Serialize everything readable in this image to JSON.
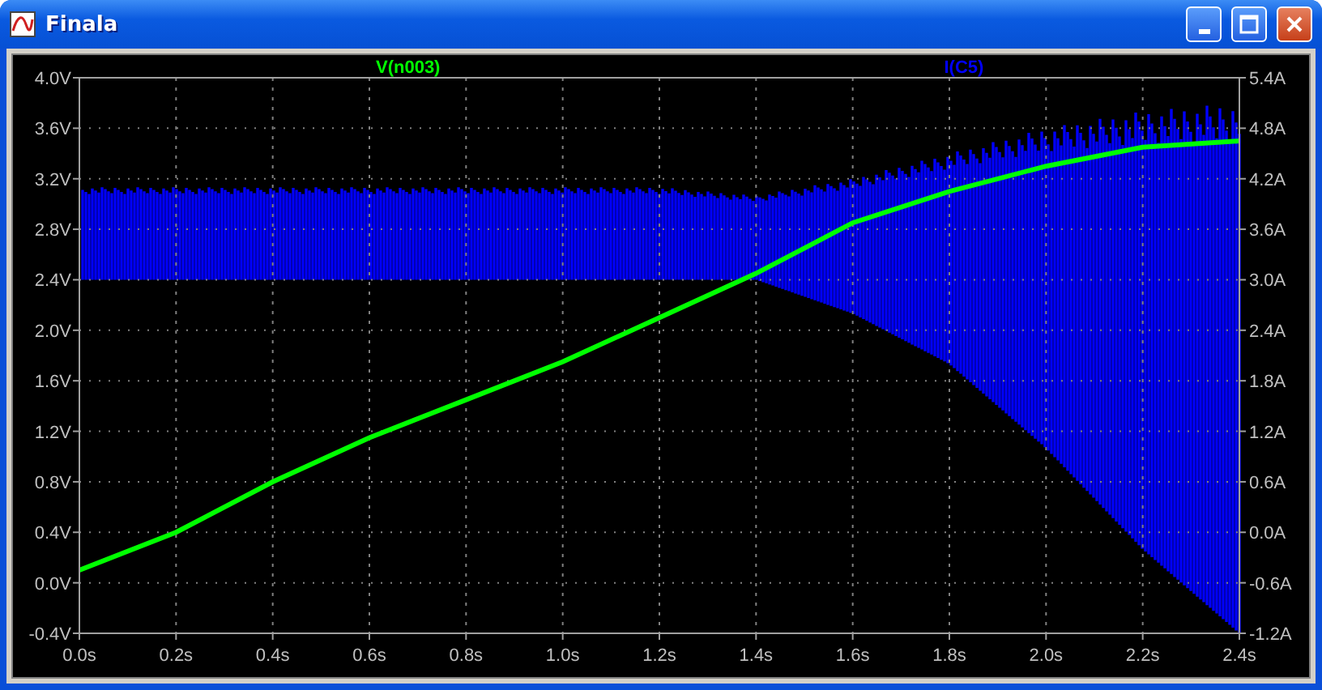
{
  "window": {
    "title": "Finala"
  },
  "plot": {
    "chart_data": {
      "type": "line",
      "x": [
        0,
        0.2,
        0.4,
        0.6,
        0.8,
        1.0,
        1.2,
        1.4,
        1.6,
        1.8,
        2.0,
        2.2,
        2.4
      ],
      "xlim": [
        0,
        2.4
      ],
      "ylim": [
        -0.4,
        4.0
      ],
      "xticks": [
        {
          "value": 0,
          "label": "0.0s"
        },
        {
          "value": 0.2,
          "label": "0.2s"
        },
        {
          "value": 0.4,
          "label": "0.4s"
        },
        {
          "value": 0.6,
          "label": "0.6s"
        },
        {
          "value": 0.8,
          "label": "0.8s"
        },
        {
          "value": 1.0,
          "label": "1.0s"
        },
        {
          "value": 1.2,
          "label": "1.2s"
        },
        {
          "value": 1.4,
          "label": "1.4s"
        },
        {
          "value": 1.6,
          "label": "1.6s"
        },
        {
          "value": 1.8,
          "label": "1.8s"
        },
        {
          "value": 2.0,
          "label": "2.0s"
        },
        {
          "value": 2.2,
          "label": "2.2s"
        },
        {
          "value": 2.4,
          "label": "2.4s"
        }
      ],
      "yticks": [
        {
          "value": 4.0,
          "label": "4.0V"
        },
        {
          "value": 3.6,
          "label": "3.6V"
        },
        {
          "value": 3.2,
          "label": "3.2V"
        },
        {
          "value": 2.8,
          "label": "2.8V"
        },
        {
          "value": 2.4,
          "label": "2.4V"
        },
        {
          "value": 2.0,
          "label": "2.0V"
        },
        {
          "value": 1.6,
          "label": "1.6V"
        },
        {
          "value": 1.2,
          "label": "1.2V"
        },
        {
          "value": 0.8,
          "label": "0.8V"
        },
        {
          "value": 0.4,
          "label": "0.4V"
        },
        {
          "value": 0.0,
          "label": "0.0V"
        },
        {
          "value": -0.4,
          "label": "-0.4V"
        }
      ],
      "grid": true,
      "y2lim": [
        -1.2,
        5.4
      ],
      "y2ticks": [
        {
          "value": 5.4,
          "label": "5.4A"
        },
        {
          "value": 4.8,
          "label": "4.8A"
        },
        {
          "value": 4.2,
          "label": "4.2A"
        },
        {
          "value": 3.6,
          "label": "3.6A"
        },
        {
          "value": 3.0,
          "label": "3.0A"
        },
        {
          "value": 2.4,
          "label": "2.4A"
        },
        {
          "value": 1.8,
          "label": "1.8A"
        },
        {
          "value": 1.2,
          "label": "1.2A"
        },
        {
          "value": 0.6,
          "label": "0.6A"
        },
        {
          "value": 0.0,
          "label": "0.0A"
        },
        {
          "value": -0.6,
          "label": "-0.6A"
        },
        {
          "value": -1.2,
          "label": "-1.2A"
        }
      ],
      "series": [
        {
          "name": "V(n003)",
          "color": "#00ff00",
          "values": [
            0.1,
            0.4,
            0.8,
            1.15,
            1.45,
            1.75,
            2.1,
            2.45,
            2.85,
            3.1,
            3.3,
            3.45,
            3.5
          ]
        }
      ]
    },
    "current_trace": {
      "label": "I(C5)",
      "color": "#0000ff"
    }
  }
}
